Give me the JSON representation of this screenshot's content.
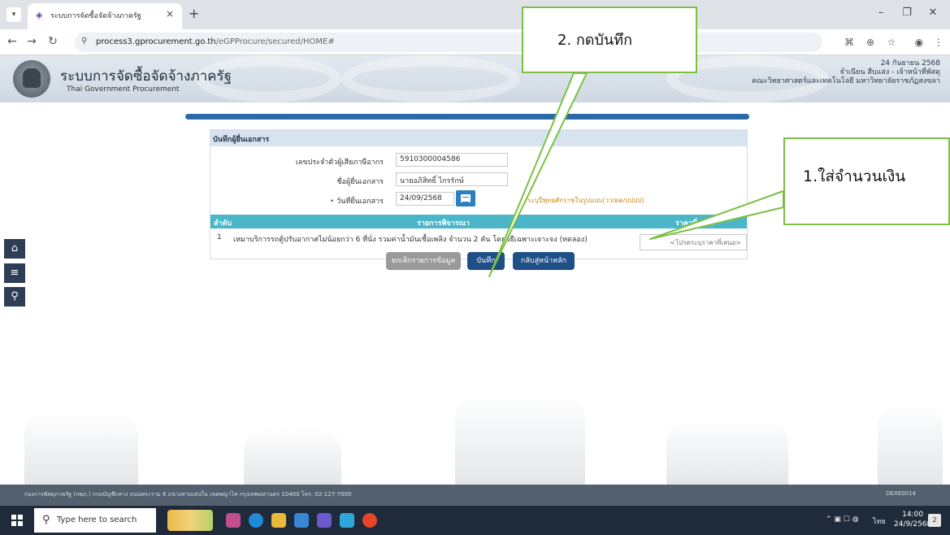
{
  "browser": {
    "tab_title": "ระบบการจัดซื้อจัดจ้างภาครัฐ",
    "url_host": "process3.gprocurement.go.th",
    "url_path": "/eGPProcure/secured/HOME#"
  },
  "header": {
    "title": "ระบบการจัดซื้อจัดจ้างภาครัฐ",
    "subtitle": "Thai Government Procurement",
    "date": "24 กันยายน 2568",
    "user": "จำเนียน สืบแสง - เจ้าหน้าที่พัสดุ",
    "org": "คณะวิทยาศาสตร์และเทคโนโลยี มหาวิทยาลัยราชภัฏสงขลา"
  },
  "form": {
    "section_title": "บันทึกผู้ยื่นเอกสาร",
    "tax_id_label": "เลขประจำตัวผู้เสียภาษีอากร",
    "tax_id_value": "5910300004586",
    "name_label": "ชื่อผู้ยื่นเอกสาร",
    "name_value": "นายอภิสิทธิ์ ไกรรักษ์",
    "date_label": "วันที่ยื่นเอกสาร",
    "date_value": "24/09/2568",
    "date_hint": "ระบุปีพุทธศักราชในรูปแบบ(วว/ดด/ปปปป)"
  },
  "table": {
    "col_no": "ลำดับ",
    "col_item": "รายการพิจารณา",
    "col_price": "ราคาที่เสนอ",
    "rows": [
      {
        "no": "1",
        "item": "เหมาบริการรถตู้ปรับอากาศไม่น้อยกว่า 6 ที่นั่ง รวมค่าน้ำมันเชื้อเพลิง จำนวน 2 คัน โดยวิธีเฉพาะเจาะจง (ทดลอง)",
        "price_placeholder": "<โปรดระบุราคาที่เสนอ>"
      }
    ]
  },
  "buttons": {
    "cancel": "ยกเลิกรายการข้อมูล",
    "save": "บันทึก",
    "back": "กลับสู่หน้าหลัก"
  },
  "annotations": {
    "step1": "1.ใส่จำนวนเงิน",
    "step2": "2. กดบันทึก",
    "color": "#7bc043"
  },
  "footer": {
    "address": "กองการพัสดุภาครัฐ (กพภ.) กรมบัญชีกลาง ถนนพระราม 6 แขวงสามเสนใน เขตพญาไท กรุงเทพมหานคร 10400 โทร. 02-127-7000",
    "code": "DEXE0014"
  },
  "taskbar": {
    "search_placeholder": "Type here to search",
    "lang": "ไทย",
    "time": "14:00",
    "date": "24/9/2568",
    "notifications": "2"
  }
}
